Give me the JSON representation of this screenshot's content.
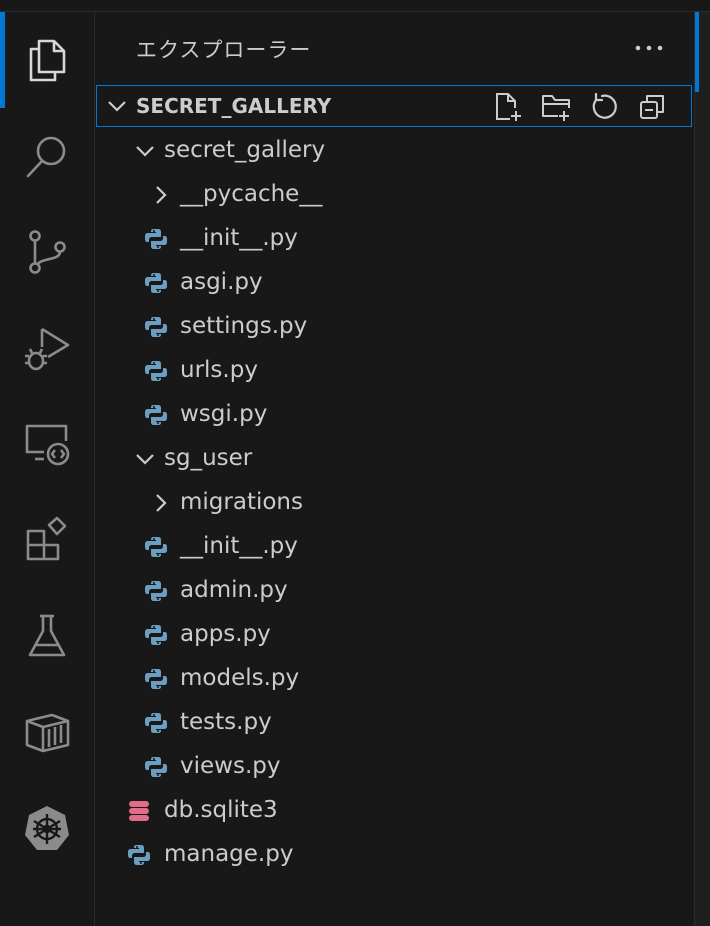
{
  "activity_bar": {
    "items": [
      {
        "icon": "explorer-icon"
      },
      {
        "icon": "search-icon"
      },
      {
        "icon": "source-control-icon"
      },
      {
        "icon": "run-debug-icon"
      },
      {
        "icon": "remote-explorer-icon"
      },
      {
        "icon": "extensions-icon"
      },
      {
        "icon": "testing-icon"
      },
      {
        "icon": "containers-icon"
      },
      {
        "icon": "kubernetes-icon"
      }
    ]
  },
  "explorer": {
    "title": "エクスプローラー",
    "more_icon": "ellipsis-icon",
    "section": {
      "label": "SECRET_GALLERY",
      "actions": [
        "new-file-icon",
        "new-folder-icon",
        "refresh-icon",
        "collapse-all-icon"
      ]
    },
    "tree": [
      {
        "label": "secret_gallery",
        "type": "folder",
        "expanded": true,
        "depth": 0
      },
      {
        "label": "__pycache__",
        "type": "folder",
        "expanded": false,
        "depth": 1
      },
      {
        "label": "__init__.py",
        "type": "python",
        "depth": 1
      },
      {
        "label": "asgi.py",
        "type": "python",
        "depth": 1
      },
      {
        "label": "settings.py",
        "type": "python",
        "depth": 1
      },
      {
        "label": "urls.py",
        "type": "python",
        "depth": 1
      },
      {
        "label": "wsgi.py",
        "type": "python",
        "depth": 1
      },
      {
        "label": "sg_user",
        "type": "folder",
        "expanded": true,
        "depth": 0
      },
      {
        "label": "migrations",
        "type": "folder",
        "expanded": false,
        "depth": 1
      },
      {
        "label": "__init__.py",
        "type": "python",
        "depth": 1
      },
      {
        "label": "admin.py",
        "type": "python",
        "depth": 1
      },
      {
        "label": "apps.py",
        "type": "python",
        "depth": 1
      },
      {
        "label": "models.py",
        "type": "python",
        "depth": 1
      },
      {
        "label": "tests.py",
        "type": "python",
        "depth": 1
      },
      {
        "label": "views.py",
        "type": "python",
        "depth": 1
      },
      {
        "label": "db.sqlite3",
        "type": "database",
        "depth": 0
      },
      {
        "label": "manage.py",
        "type": "python",
        "depth": 0
      }
    ]
  },
  "colors": {
    "accent": "#0078d4",
    "python_icon": "#6a9fc2",
    "database_icon": "#e06c88",
    "text": "#cccccc",
    "background": "#181818"
  }
}
